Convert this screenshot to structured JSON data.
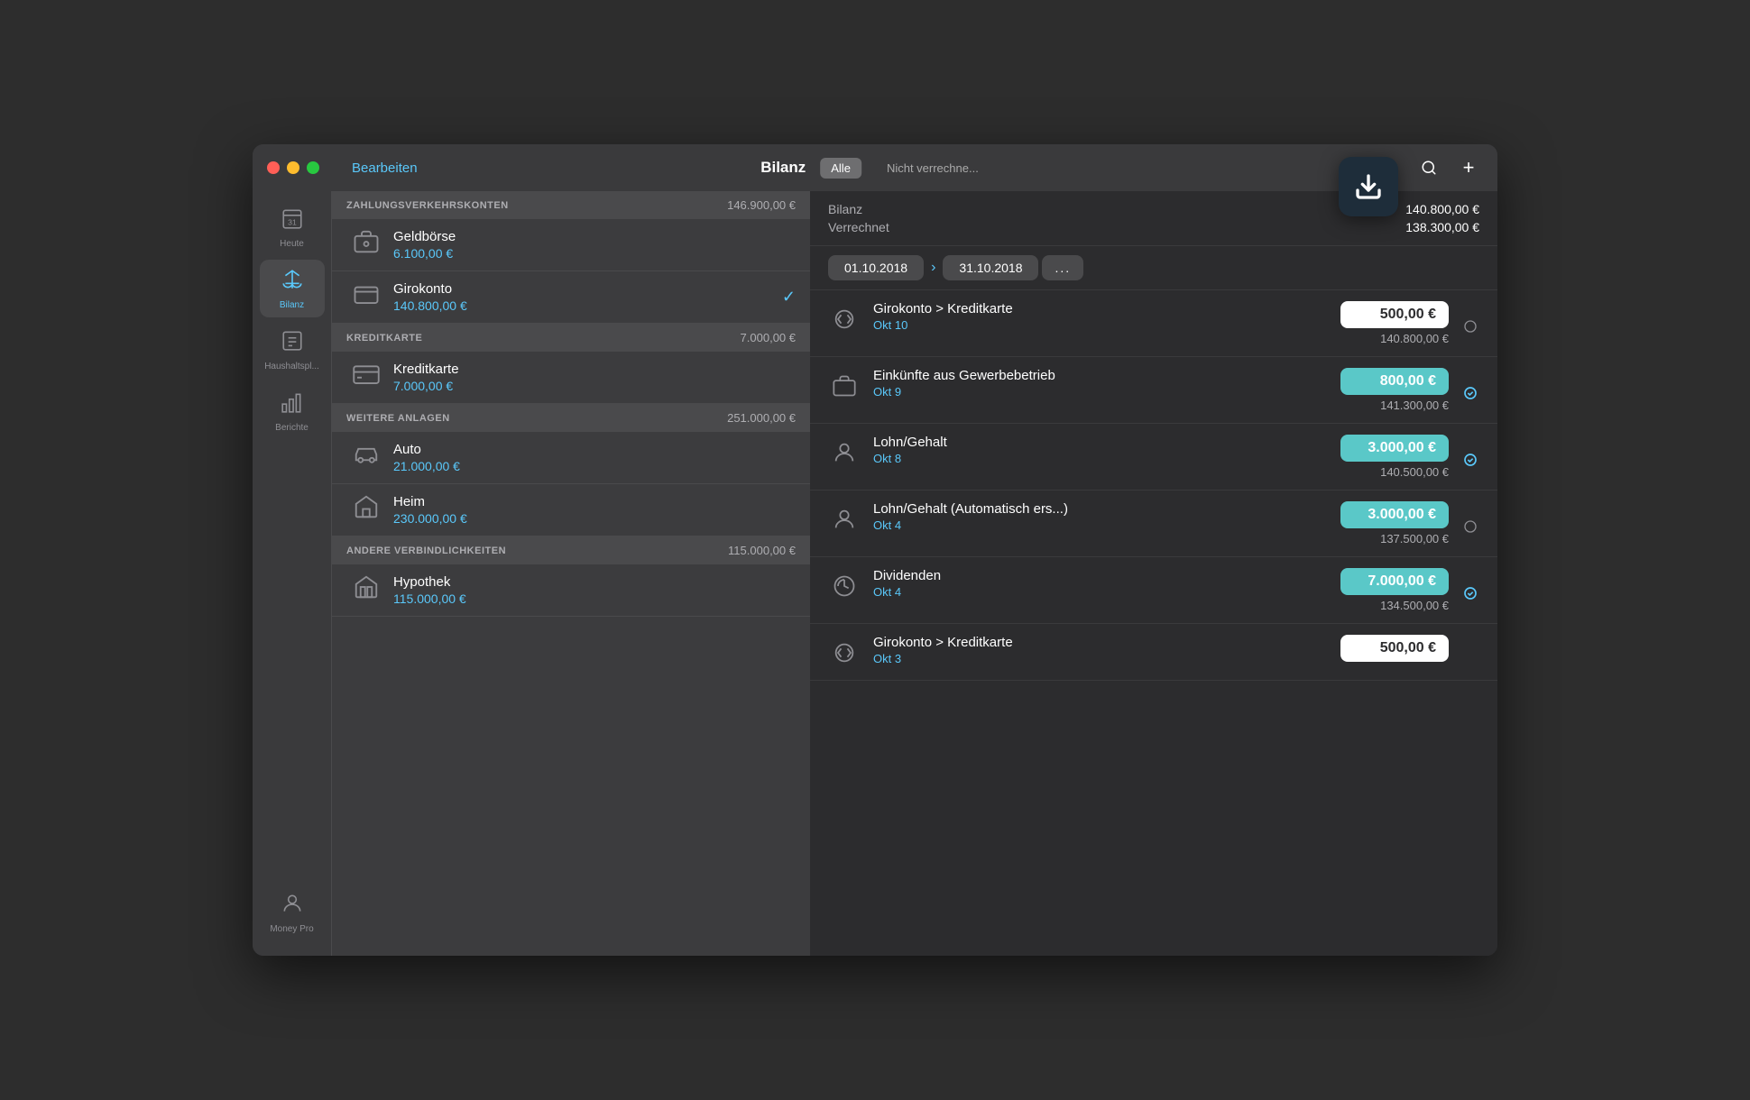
{
  "window": {
    "title": "Bilanz"
  },
  "titlebar": {
    "edit_label": "Bearbeiten",
    "title": "Bilanz",
    "filter_all": "Alle",
    "filter_unverrechnet": "Nicht verrechne...",
    "download_tooltip": "Download"
  },
  "sidebar": {
    "items": [
      {
        "id": "heute",
        "label": "Heute",
        "icon": "📅"
      },
      {
        "id": "bilanz",
        "label": "Bilanz",
        "icon": "⚖️",
        "active": true
      },
      {
        "id": "haushaltsplan",
        "label": "Haushaltspl...",
        "icon": "🗂️"
      },
      {
        "id": "berichte",
        "label": "Berichte",
        "icon": "📊"
      }
    ],
    "bottom": {
      "label": "Money Pro",
      "icon": "👤"
    }
  },
  "left_panel": {
    "sections": [
      {
        "id": "zahlungsverkehr",
        "title": "ZAHLUNGSVERKEHRSKONTEN",
        "amount": "146.900,00 €",
        "accounts": [
          {
            "id": "geldborse",
            "name": "Geldbörse",
            "balance": "6.100,00 €",
            "icon": "wallet",
            "checked": false
          },
          {
            "id": "girokonto",
            "name": "Girokonto",
            "balance": "140.800,00 €",
            "icon": "wallet2",
            "checked": true
          }
        ]
      },
      {
        "id": "kreditkarte",
        "title": "KREDITKARTE",
        "amount": "7.000,00 €",
        "accounts": [
          {
            "id": "kreditkarte",
            "name": "Kreditkarte",
            "balance": "7.000,00 €",
            "icon": "creditcard",
            "checked": false
          }
        ]
      },
      {
        "id": "weitere_anlagen",
        "title": "WEITERE ANLAGEN",
        "amount": "251.000,00 €",
        "accounts": [
          {
            "id": "auto",
            "name": "Auto",
            "balance": "21.000,00 €",
            "icon": "car",
            "checked": false
          },
          {
            "id": "heim",
            "name": "Heim",
            "balance": "230.000,00 €",
            "icon": "house",
            "checked": false
          }
        ]
      },
      {
        "id": "andere_verbindlichkeiten",
        "title": "ANDERE VERBINDLICHKEITEN",
        "amount": "115.000,00 €",
        "accounts": [
          {
            "id": "hypothek",
            "name": "Hypothek",
            "balance": "115.000,00 €",
            "icon": "mortgage",
            "checked": false
          }
        ]
      }
    ]
  },
  "right_panel": {
    "summary": {
      "bilanz_label": "Bilanz",
      "bilanz_value": "140.800,00 €",
      "verrechnet_label": "Verrechnet",
      "verrechnet_value": "138.300,00 €"
    },
    "date_filter": {
      "start": "01.10.2018",
      "end": "31.10.2018",
      "more": "..."
    },
    "transactions": [
      {
        "id": "tx1",
        "icon": "transfer",
        "name": "Girokonto > Kreditkarte",
        "date": "Okt 10",
        "amount": "500,00 €",
        "amount_style": "white",
        "balance": "140.800,00 €",
        "status": "circle"
      },
      {
        "id": "tx2",
        "icon": "business",
        "name": "Einkünfte aus Gewerbebetrieb",
        "date": "Okt 9",
        "amount": "800,00 €",
        "amount_style": "teal",
        "balance": "141.300,00 €",
        "status": "checkmark"
      },
      {
        "id": "tx3",
        "icon": "person",
        "name": "Lohn/Gehalt",
        "date": "Okt 8",
        "amount": "3.000,00 €",
        "amount_style": "teal",
        "balance": "140.500,00 €",
        "status": "checkmark"
      },
      {
        "id": "tx4",
        "icon": "person",
        "name": "Lohn/Gehalt (Automatisch ers...)",
        "date": "Okt 4",
        "amount": "3.000,00 €",
        "amount_style": "teal",
        "balance": "137.500,00 €",
        "status": "circle"
      },
      {
        "id": "tx5",
        "icon": "alarm",
        "name": "Dividenden",
        "date": "Okt 4",
        "amount": "7.000,00 €",
        "amount_style": "teal",
        "balance": "134.500,00 €",
        "status": "checkmark"
      },
      {
        "id": "tx6",
        "icon": "transfer",
        "name": "Girokonto > Kreditkarte",
        "date": "Okt 3",
        "amount": "500,00 €",
        "amount_style": "white",
        "balance": "",
        "status": "transfer"
      }
    ]
  },
  "icons": {
    "wallet": "👛",
    "wallet2": "💳",
    "creditcard": "💳",
    "car": "🚗",
    "house": "🏠",
    "mortgage": "🏦",
    "transfer": "🔄",
    "business": "💼",
    "person": "👤",
    "alarm": "⏰",
    "search": "🔍",
    "plus": "+",
    "download": "⬇"
  }
}
